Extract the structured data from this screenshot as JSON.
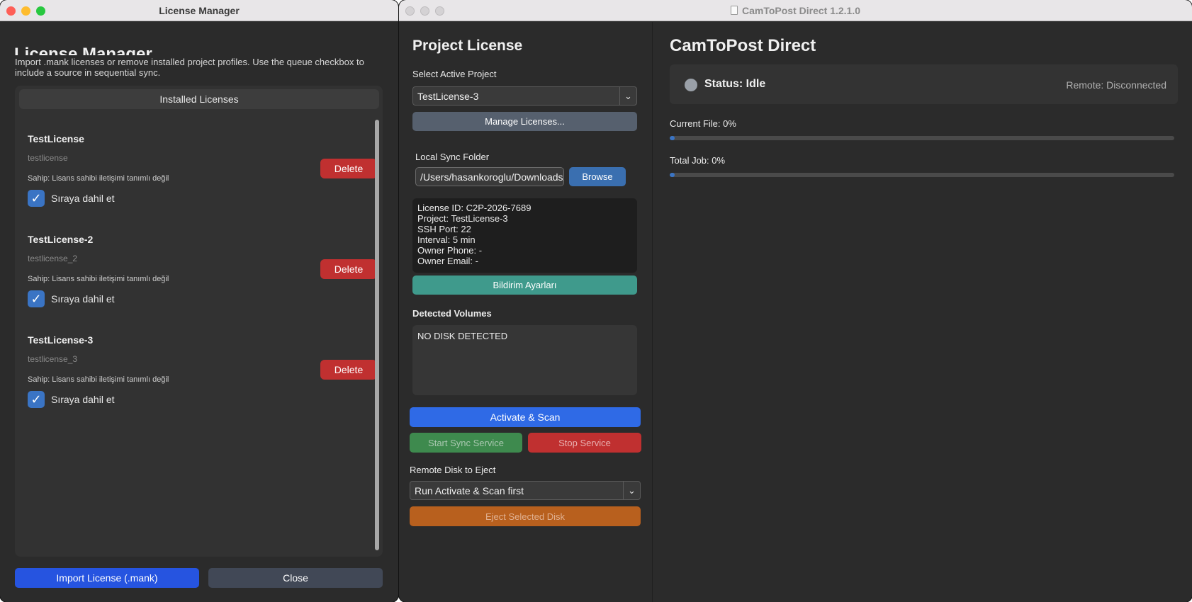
{
  "license_manager": {
    "window_title": "License Manager",
    "heading": "License Manager",
    "description": "Import .mank licenses or remove installed project profiles. Use the queue checkbox to include a source in sequential sync.",
    "tab_label": "Installed Licenses",
    "licenses": [
      {
        "name": "TestLicense",
        "key": "testlicense",
        "owner": "Sahip: Lisans sahibi iletişimi tanımlı değil",
        "queue_label": "Sıraya dahil et",
        "queued": true,
        "delete_label": "Delete"
      },
      {
        "name": "TestLicense-2",
        "key": "testlicense_2",
        "owner": "Sahip: Lisans sahibi iletişimi tanımlı değil",
        "queue_label": "Sıraya dahil et",
        "queued": true,
        "delete_label": "Delete"
      },
      {
        "name": "TestLicense-3",
        "key": "testlicense_3",
        "owner": "Sahip: Lisans sahibi iletişimi tanımlı değil",
        "queue_label": "Sıraya dahil et",
        "queued": true,
        "delete_label": "Delete"
      }
    ],
    "import_label": "Import License (.mank)",
    "close_label": "Close"
  },
  "main_window": {
    "window_title": "CamToPost Direct 1.2.1.0",
    "project_panel": {
      "heading": "Project License",
      "select_project_label": "Select Active Project",
      "selected_project": "TestLicense-3",
      "manage_label": "Manage Licenses...",
      "sync_folder_label": "Local Sync Folder",
      "sync_folder_value": "/Users/hasankoroglu/Downloads/CamToPost",
      "browse_label": "Browse",
      "info_lines": [
        "License ID: C2P-2026-7689",
        "Project: TestLicense-3",
        "SSH Port: 22",
        "Interval: 5 min",
        "Owner Phone: -",
        "Owner Email: -"
      ],
      "notification_label": "Bildirim Ayarları",
      "volumes_label": "Detected Volumes",
      "volumes_value": "NO DISK DETECTED",
      "activate_label": "Activate & Scan",
      "start_sync_label": "Start Sync Service",
      "stop_service_label": "Stop Service",
      "eject_label": "Remote Disk to Eject",
      "eject_select_value": "Run Activate & Scan first",
      "eject_button_label": "Eject Selected Disk"
    },
    "status_panel": {
      "heading": "CamToPost Direct",
      "status": "Status: Idle",
      "remote": "Remote: Disconnected",
      "current_file_label": "Current File: 0%",
      "current_file_progress": 0,
      "total_job_label": "Total Job: 0%",
      "total_job_progress": 0
    }
  },
  "colors": {
    "delete": "#c03030",
    "import": "#2654e0",
    "browse": "#3a6fb0",
    "notification": "#3f9a8c",
    "activate": "#2f6ae6",
    "start_sync": "#3e8a4e",
    "stop": "#c03030",
    "eject": "#b8601e"
  }
}
